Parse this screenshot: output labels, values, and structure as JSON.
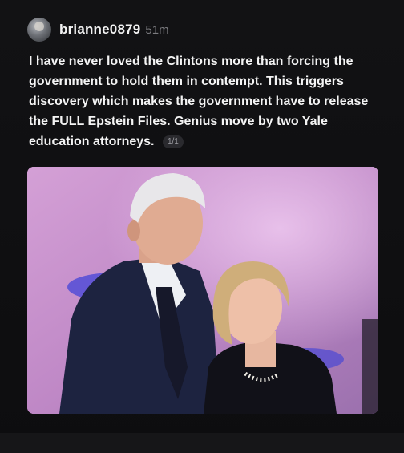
{
  "post": {
    "username": "brianne0879",
    "timestamp": "51m",
    "text": "I have never loved the Clintons more than forcing the government to hold them in contempt. This triggers discovery which makes the government have to release the FULL Epstein Files. Genius move by two Yale education attorneys.",
    "media_counter": "1/1"
  },
  "icons": {
    "avatar": "user-avatar"
  },
  "colors": {
    "background": "#0b0b0c",
    "text": "#f4f4f4",
    "muted": "#7c7c80",
    "photo_backdrop": "#c893c9"
  }
}
